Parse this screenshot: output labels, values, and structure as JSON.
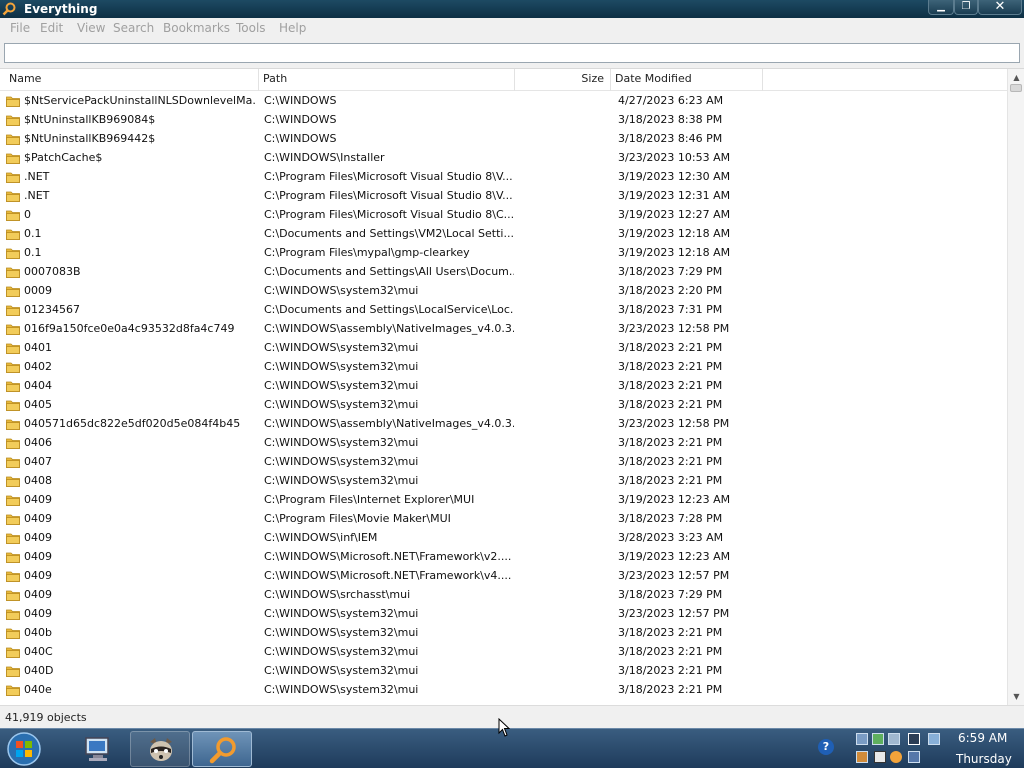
{
  "window": {
    "title": "Everything",
    "btn_min": "▁",
    "btn_max": "❐",
    "btn_close": "✕"
  },
  "menu": [
    "File",
    "Edit",
    "View",
    "Search",
    "Bookmarks",
    "Tools",
    "Help"
  ],
  "search": {
    "value": "",
    "placeholder": ""
  },
  "columns": {
    "name": "Name",
    "path": "Path",
    "size": "Size",
    "date": "Date Modified"
  },
  "rows": [
    {
      "name": "$NtServicePackUninstallNLSDownlevelMa...",
      "path": "C:\\WINDOWS",
      "size": "",
      "date": "4/27/2023 6:23 AM"
    },
    {
      "name": "$NtUninstallKB969084$",
      "path": "C:\\WINDOWS",
      "size": "",
      "date": "3/18/2023 8:38 PM"
    },
    {
      "name": "$NtUninstallKB969442$",
      "path": "C:\\WINDOWS",
      "size": "",
      "date": "3/18/2023 8:46 PM"
    },
    {
      "name": "$PatchCache$",
      "path": "C:\\WINDOWS\\Installer",
      "size": "",
      "date": "3/23/2023 10:53 AM"
    },
    {
      "name": ".NET",
      "path": "C:\\Program Files\\Microsoft Visual Studio 8\\V...",
      "size": "",
      "date": "3/19/2023 12:30 AM"
    },
    {
      "name": ".NET",
      "path": "C:\\Program Files\\Microsoft Visual Studio 8\\V...",
      "size": "",
      "date": "3/19/2023 12:31 AM"
    },
    {
      "name": "0",
      "path": "C:\\Program Files\\Microsoft Visual Studio 8\\C...",
      "size": "",
      "date": "3/19/2023 12:27 AM"
    },
    {
      "name": "0.1",
      "path": "C:\\Documents and Settings\\VM2\\Local Setti...",
      "size": "",
      "date": "3/19/2023 12:18 AM"
    },
    {
      "name": "0.1",
      "path": "C:\\Program Files\\mypal\\gmp-clearkey",
      "size": "",
      "date": "3/19/2023 12:18 AM"
    },
    {
      "name": "0007083B",
      "path": "C:\\Documents and Settings\\All Users\\Docum...",
      "size": "",
      "date": "3/18/2023 7:29 PM"
    },
    {
      "name": "0009",
      "path": "C:\\WINDOWS\\system32\\mui",
      "size": "",
      "date": "3/18/2023 2:20 PM"
    },
    {
      "name": "01234567",
      "path": "C:\\Documents and Settings\\LocalService\\Loc...",
      "size": "",
      "date": "3/18/2023 7:31 PM"
    },
    {
      "name": "016f9a150fce0e0a4c93532d8fa4c749",
      "path": "C:\\WINDOWS\\assembly\\NativeImages_v4.0.3...",
      "size": "",
      "date": "3/23/2023 12:58 PM"
    },
    {
      "name": "0401",
      "path": "C:\\WINDOWS\\system32\\mui",
      "size": "",
      "date": "3/18/2023 2:21 PM"
    },
    {
      "name": "0402",
      "path": "C:\\WINDOWS\\system32\\mui",
      "size": "",
      "date": "3/18/2023 2:21 PM"
    },
    {
      "name": "0404",
      "path": "C:\\WINDOWS\\system32\\mui",
      "size": "",
      "date": "3/18/2023 2:21 PM"
    },
    {
      "name": "0405",
      "path": "C:\\WINDOWS\\system32\\mui",
      "size": "",
      "date": "3/18/2023 2:21 PM"
    },
    {
      "name": "040571d65dc822e5df020d5e084f4b45",
      "path": "C:\\WINDOWS\\assembly\\NativeImages_v4.0.3...",
      "size": "",
      "date": "3/23/2023 12:58 PM"
    },
    {
      "name": "0406",
      "path": "C:\\WINDOWS\\system32\\mui",
      "size": "",
      "date": "3/18/2023 2:21 PM"
    },
    {
      "name": "0407",
      "path": "C:\\WINDOWS\\system32\\mui",
      "size": "",
      "date": "3/18/2023 2:21 PM"
    },
    {
      "name": "0408",
      "path": "C:\\WINDOWS\\system32\\mui",
      "size": "",
      "date": "3/18/2023 2:21 PM"
    },
    {
      "name": "0409",
      "path": "C:\\Program Files\\Internet Explorer\\MUI",
      "size": "",
      "date": "3/19/2023 12:23 AM"
    },
    {
      "name": "0409",
      "path": "C:\\Program Files\\Movie Maker\\MUI",
      "size": "",
      "date": "3/18/2023 7:28 PM"
    },
    {
      "name": "0409",
      "path": "C:\\WINDOWS\\inf\\IEM",
      "size": "",
      "date": "3/28/2023 3:23 AM"
    },
    {
      "name": "0409",
      "path": "C:\\WINDOWS\\Microsoft.NET\\Framework\\v2....",
      "size": "",
      "date": "3/19/2023 12:23 AM"
    },
    {
      "name": "0409",
      "path": "C:\\WINDOWS\\Microsoft.NET\\Framework\\v4....",
      "size": "",
      "date": "3/23/2023 12:57 PM"
    },
    {
      "name": "0409",
      "path": "C:\\WINDOWS\\srchasst\\mui",
      "size": "",
      "date": "3/18/2023 7:29 PM"
    },
    {
      "name": "0409",
      "path": "C:\\WINDOWS\\system32\\mui",
      "size": "",
      "date": "3/23/2023 12:57 PM"
    },
    {
      "name": "040b",
      "path": "C:\\WINDOWS\\system32\\mui",
      "size": "",
      "date": "3/18/2023 2:21 PM"
    },
    {
      "name": "040C",
      "path": "C:\\WINDOWS\\system32\\mui",
      "size": "",
      "date": "3/18/2023 2:21 PM"
    },
    {
      "name": "040D",
      "path": "C:\\WINDOWS\\system32\\mui",
      "size": "",
      "date": "3/18/2023 2:21 PM"
    },
    {
      "name": "040e",
      "path": "C:\\WINDOWS\\system32\\mui",
      "size": "",
      "date": "3/18/2023 2:21 PM"
    }
  ],
  "status": {
    "text": "41,919 objects"
  },
  "taskbar": {
    "buttons": [
      "computer-icon",
      "raccoon-icon",
      "everything-icon"
    ],
    "active": "Everything"
  },
  "tray": {
    "help": "?",
    "time": "6:59 AM",
    "day": "Thursday"
  },
  "colors": {
    "folder": "#e8b93c",
    "title_bar": "#0d2f44",
    "taskbar": "#2a4a6c"
  }
}
